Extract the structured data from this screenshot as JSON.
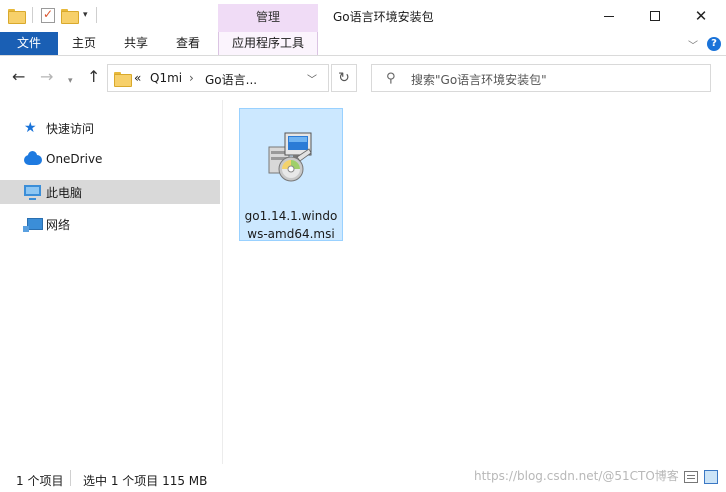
{
  "window": {
    "title": "Go语言环境安装包",
    "contextual_group": "管理"
  },
  "ribbon": {
    "tabs": [
      {
        "label": "文件"
      },
      {
        "label": "主页"
      },
      {
        "label": "共享"
      },
      {
        "label": "查看"
      },
      {
        "label": "应用程序工具"
      }
    ],
    "help_label": "?"
  },
  "address": {
    "overflow": "«",
    "segments": [
      "Q1mi",
      "Go语言..."
    ],
    "separator": "›"
  },
  "search": {
    "placeholder": "搜索\"Go语言环境安装包\""
  },
  "sidebar": {
    "items": [
      {
        "label": "快速访问",
        "icon": "quick-access-star-icon"
      },
      {
        "label": "OneDrive",
        "icon": "onedrive-cloud-icon"
      },
      {
        "label": "此电脑",
        "icon": "this-pc-icon",
        "selected": true
      },
      {
        "label": "网络",
        "icon": "network-icon"
      }
    ]
  },
  "files": [
    {
      "name_line1": "go1.14.1.windo",
      "name_line2": "ws-amd64.msi",
      "icon": "msi-installer-icon",
      "selected": true
    }
  ],
  "status": {
    "item_count": "1 个项目",
    "selection": "选中 1 个项目  115 MB",
    "watermark": "https://blog.csdn.net/@51CTO博客"
  },
  "colors": {
    "file_tab_bg": "#1a5fb4",
    "contextual_tab_bg": "#f0dcf6",
    "selection_bg": "#cce8ff",
    "sidebar_selected_bg": "#d9d9d9"
  }
}
